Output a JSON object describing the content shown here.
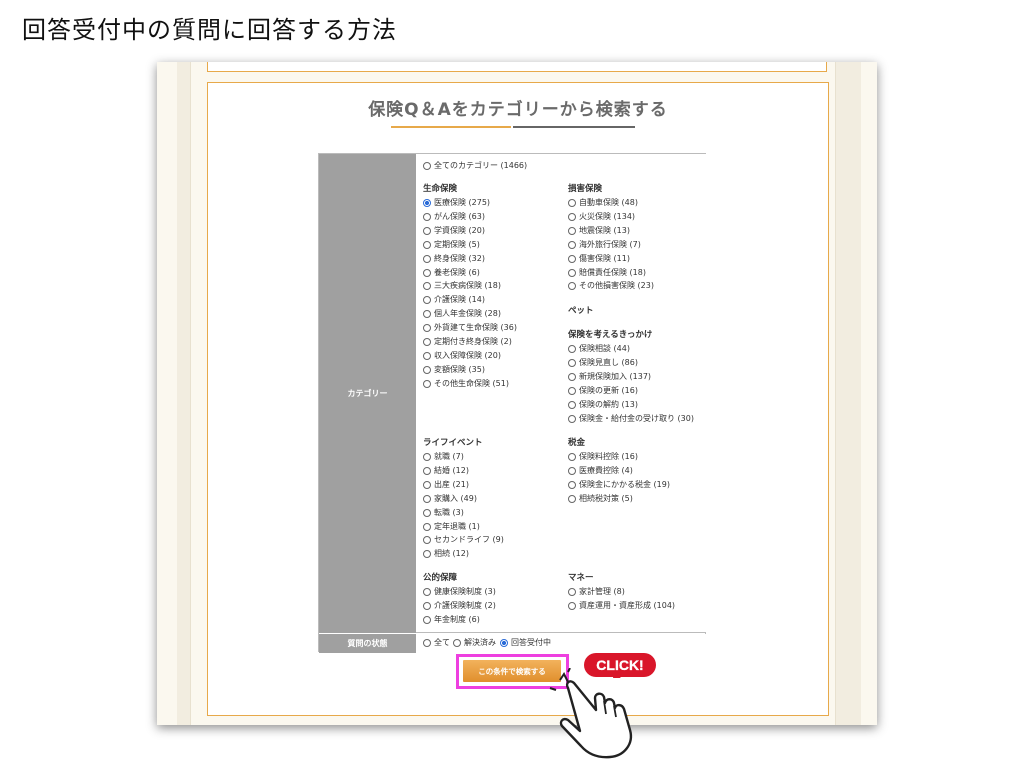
{
  "page_title": "回答受付中の質問に回答する方法",
  "section_title": "保険Q＆Aをカテゴリーから検索する",
  "labels": {
    "category": "カテゴリー",
    "status": "質問の状態"
  },
  "all_categories": "全てのカテゴリー (1466)",
  "groups": {
    "life": {
      "title": "生命保険",
      "items": [
        "医療保険 (275)",
        "がん保険 (63)",
        "学資保険 (20)",
        "定期保険 (5)",
        "終身保険 (32)",
        "養老保険 (6)",
        "三大疾病保険 (18)",
        "介護保険 (14)",
        "個人年金保険 (28)",
        "外貨建て生命保険 (36)",
        "定期付き終身保険 (2)",
        "収入保障保険 (20)",
        "変額保険 (35)",
        "その他生命保険 (51)"
      ]
    },
    "damage": {
      "title": "損害保険",
      "items": [
        "自動車保険 (48)",
        "火災保険 (134)",
        "地震保険 (13)",
        "海外旅行保険 (7)",
        "傷害保険 (11)",
        "賠償責任保険 (18)",
        "その他損害保険 (23)"
      ]
    },
    "pet": {
      "title": "ペット"
    },
    "trigger": {
      "title": "保険を考えるきっかけ",
      "items": [
        "保険相談 (44)",
        "保険見直し (86)",
        "新規保険加入 (137)",
        "保険の更新 (16)",
        "保険の解約 (13)",
        "保険金・給付金の受け取り (30)"
      ]
    },
    "lifeevent": {
      "title": "ライフイベント",
      "items": [
        "就職 (7)",
        "結婚 (12)",
        "出産 (21)",
        "家購入 (49)",
        "転職 (3)",
        "定年退職 (1)",
        "セカンドライフ (9)",
        "相続 (12)"
      ]
    },
    "tax": {
      "title": "税金",
      "items": [
        "保険料控除 (16)",
        "医療費控除 (4)",
        "保険金にかかる税金 (19)",
        "相続税対策 (5)"
      ]
    },
    "public": {
      "title": "公的保障",
      "items": [
        "健康保険制度 (3)",
        "介護保険制度 (2)",
        "年金制度 (6)"
      ]
    },
    "money": {
      "title": "マネー",
      "items": [
        "家計管理 (8)",
        "資産運用・資産形成 (104)"
      ]
    }
  },
  "selected_category": "医療保険 (275)",
  "status_options": [
    "全て",
    "解決済み",
    "回答受付中"
  ],
  "selected_status": "回答受付中",
  "search_button": "この条件で検索する",
  "click_badge": "CLICK!",
  "colors": {
    "accent_orange": "#e7a94a",
    "highlight_pink": "#ee3fe0",
    "click_red": "#d9162a",
    "radio_blue": "#2b6cd8"
  },
  "icons": {
    "hand": "pointing-hand-icon",
    "radio": "radio-icon"
  }
}
